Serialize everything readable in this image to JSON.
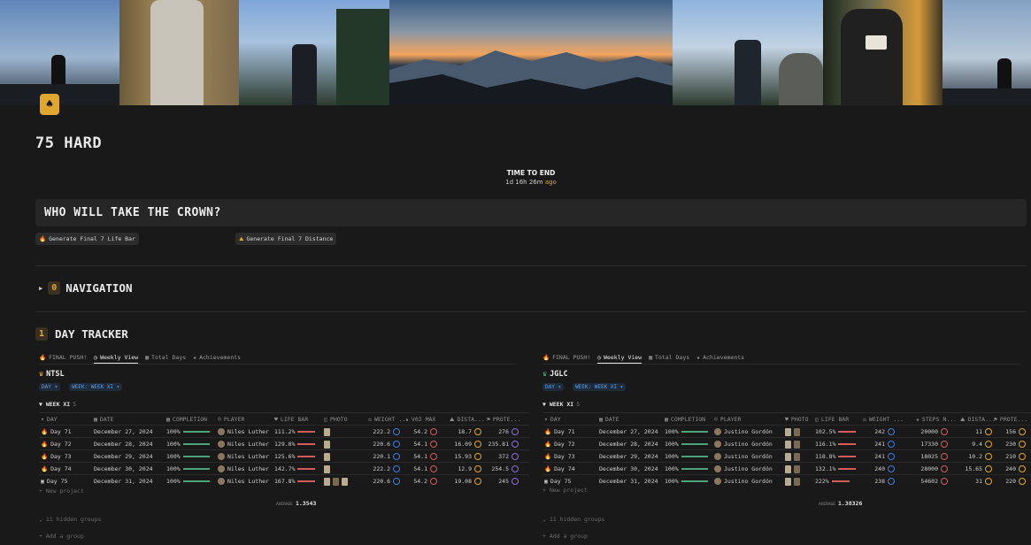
{
  "page": {
    "title": "75 HARD",
    "icon": "spade-icon"
  },
  "countdown": {
    "label": "TIME TO END",
    "value": "1d 16h 26m",
    "suffix": "ago"
  },
  "callout": {
    "title": "WHO WILL TAKE THE CROWN?"
  },
  "buttons": {
    "life_bar": "Generate Final 7 Life Bar",
    "distance": "Generate Final 7 Distance"
  },
  "navigation": {
    "badge": "0",
    "label": "NAVIGATION"
  },
  "tracker": {
    "badge": "1",
    "label": "DAY TRACKER"
  },
  "colors": {
    "accent": "#e0a630",
    "link": "#5aa0e6",
    "progress": "#4aa37a",
    "lifebar": "#d45c5c"
  },
  "panels": [
    {
      "tabs": [
        "FINAL PUSH!",
        "Weekly View",
        "Total Days",
        "Achievements"
      ],
      "title": "NTSL",
      "filters": [
        "DAY",
        "WEEK: WEEK XI"
      ],
      "group": "WEEK XI",
      "group_count": "5",
      "columns": [
        "DAY",
        "DATE",
        "COMPLETION",
        "PLAYER",
        "LIFE BAR",
        "PHOTO",
        "WEIGHT ...",
        "V02 MAX",
        "DISTA...",
        "PROTE..."
      ],
      "rows": [
        {
          "day": "Day 71",
          "date": "December 27, 2024",
          "completion": "100%",
          "player": "Niles Luther",
          "lifebar": "111.2%",
          "weight": "222.2",
          "c3": "54.2",
          "c4": "18.7",
          "c5": "276"
        },
        {
          "day": "Day 72",
          "date": "December 28, 2024",
          "completion": "100%",
          "player": "Niles Luther",
          "lifebar": "129.8%",
          "weight": "220.6",
          "c3": "54.1",
          "c4": "16.09",
          "c5": "235.81"
        },
        {
          "day": "Day 73",
          "date": "December 29, 2024",
          "completion": "100%",
          "player": "Niles Luther",
          "lifebar": "125.6%",
          "weight": "220.1",
          "c3": "54.1",
          "c4": "15.93",
          "c5": "372"
        },
        {
          "day": "Day 74",
          "date": "December 30, 2024",
          "completion": "100%",
          "player": "Niles Luther",
          "lifebar": "142.7%",
          "weight": "222.2",
          "c3": "54.1",
          "c4": "12.9",
          "c5": "254.5"
        },
        {
          "day": "Day 75",
          "date": "December 31, 2024",
          "completion": "100%",
          "player": "Niles Luther",
          "lifebar": "167.8%",
          "weight": "220.6",
          "c3": "54.2",
          "c4": "19.08",
          "c5": "245"
        }
      ],
      "new_project": "+ New project",
      "average_label": "AVERAGE",
      "average_value": "1.3543",
      "hidden_groups": "11 hidden groups",
      "add_group": "+ Add a group"
    },
    {
      "tabs": [
        "FINAL PUSH!",
        "Weekly View",
        "Total Days",
        "Achievements"
      ],
      "title": "JGLC",
      "filters": [
        "DAY",
        "WEEK: WEEK XI"
      ],
      "group": "WEEK XI",
      "group_count": "5",
      "columns": [
        "DAY",
        "DATE",
        "COMPLETION",
        "PLAYER",
        "PHOTO",
        "LIFE BAR",
        "WEIGHT ...",
        "STEPS N...",
        "DISTA...",
        "PROTE..."
      ],
      "rows": [
        {
          "day": "Day 71",
          "date": "December 27, 2024",
          "completion": "100%",
          "player": "Justino Gordón",
          "lifebar": "102.5%",
          "weight": "242",
          "c3": "20000",
          "c4": "11",
          "c5": "156"
        },
        {
          "day": "Day 72",
          "date": "December 28, 2024",
          "completion": "100%",
          "player": "Justino Gordón",
          "lifebar": "116.1%",
          "weight": "241",
          "c3": "17330",
          "c4": "9.4",
          "c5": "230"
        },
        {
          "day": "Day 73",
          "date": "December 29, 2024",
          "completion": "100%",
          "player": "Justino Gordón",
          "lifebar": "118.8%",
          "weight": "241",
          "c3": "18025",
          "c4": "10.2",
          "c5": "210"
        },
        {
          "day": "Day 74",
          "date": "December 30, 2024",
          "completion": "100%",
          "player": "Justino Gordón",
          "lifebar": "132.1%",
          "weight": "240",
          "c3": "28000",
          "c4": "15.65",
          "c5": "240"
        },
        {
          "day": "Day 75",
          "date": "December 31, 2024",
          "completion": "100%",
          "player": "Justino Gordón",
          "lifebar": "222%",
          "weight": "238",
          "c3": "54602",
          "c4": "31",
          "c5": "220"
        }
      ],
      "new_project": "+ New project",
      "average_label": "AVERAGE",
      "average_value": "1.38326",
      "hidden_groups": "11 hidden groups",
      "add_group": "+ Add a group"
    }
  ]
}
